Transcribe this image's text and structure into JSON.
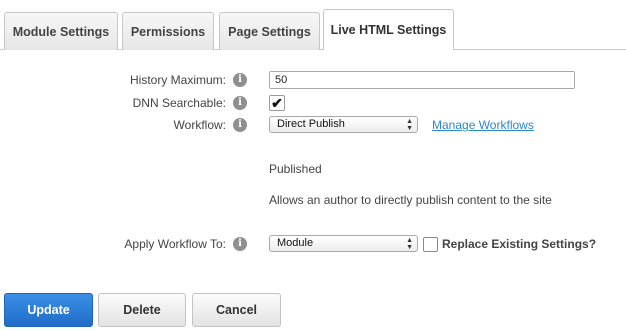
{
  "tabs": [
    {
      "label": "Module Settings",
      "active": false
    },
    {
      "label": "Permissions",
      "active": false
    },
    {
      "label": "Page Settings",
      "active": false
    },
    {
      "label": "Live HTML Settings",
      "active": true
    }
  ],
  "form": {
    "history_maximum": {
      "label": "History Maximum:",
      "value": "50"
    },
    "dnn_searchable": {
      "label": "DNN Searchable:",
      "checked": true,
      "check_glyph": "✔"
    },
    "workflow": {
      "label": "Workflow:",
      "selected": "Direct Publish",
      "link": "Manage Workflows"
    },
    "workflow_state": "Published",
    "workflow_description": "Allows an author to directly publish content to the site",
    "apply_workflow_to": {
      "label": "Apply Workflow To:",
      "selected": "Module",
      "replace_label": "Replace Existing Settings?",
      "replace_checked": false
    }
  },
  "info_icon_glyph": "i",
  "select_arrows": {
    "up": "▲",
    "down": "▼"
  },
  "buttons": {
    "update": "Update",
    "delete": "Delete",
    "cancel": "Cancel"
  },
  "colors": {
    "primary_button": "#2a7bd6",
    "link": "#2a89c9",
    "info_icon": "#8f8f8f"
  }
}
